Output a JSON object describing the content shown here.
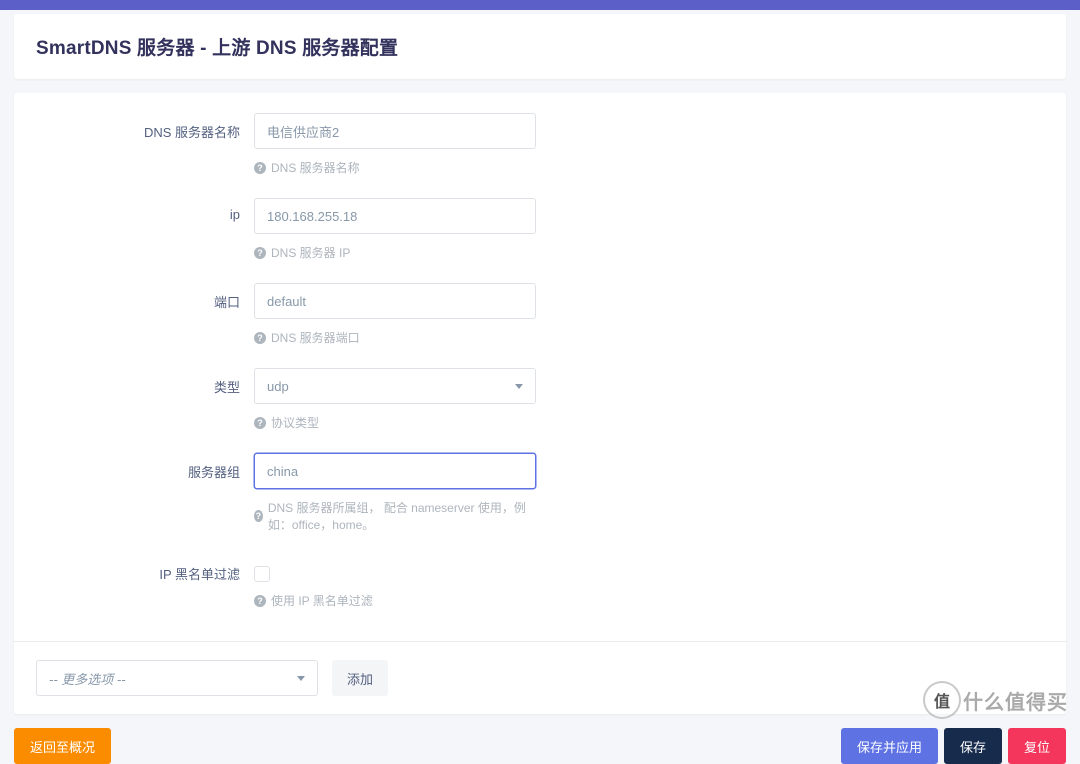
{
  "header": {
    "title": "SmartDNS 服务器 - 上游 DNS 服务器配置"
  },
  "form": {
    "name": {
      "label": "DNS 服务器名称",
      "value": "电信供应商2",
      "help": "DNS 服务器名称"
    },
    "ip": {
      "label": "ip",
      "value": "180.168.255.18",
      "help": "DNS 服务器 IP"
    },
    "port": {
      "label": "端口",
      "value": "default",
      "help": "DNS 服务器端口"
    },
    "type": {
      "label": "类型",
      "value": "udp",
      "help": "协议类型"
    },
    "group": {
      "label": "服务器组",
      "value": "china",
      "help": "DNS 服务器所属组， 配合 nameserver 使用，例如：office，home。"
    },
    "blacklist": {
      "label": "IP 黑名单过滤",
      "help": "使用 IP 黑名单过滤"
    }
  },
  "options": {
    "more_options": "-- 更多选项 --",
    "add": "添加"
  },
  "actions": {
    "back": "返回至概况",
    "save_apply": "保存并应用",
    "save": "保存",
    "reset": "复位"
  },
  "watermark": {
    "badge": "值",
    "text": "什么值得买"
  }
}
